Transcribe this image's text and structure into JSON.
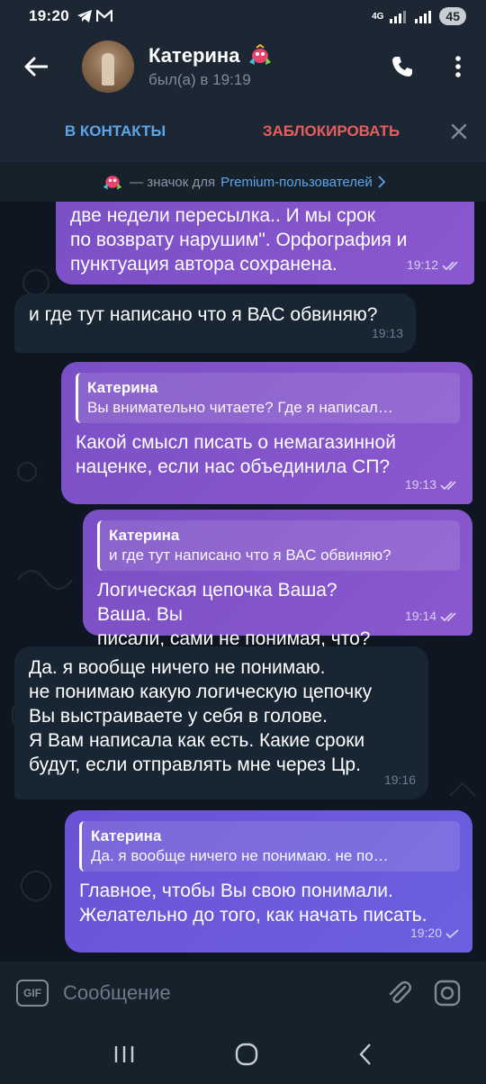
{
  "status_bar": {
    "time": "19:20",
    "network": "4G",
    "battery": "45"
  },
  "header": {
    "contact_name": "Катерина",
    "last_seen": "был(а) в 19:19"
  },
  "action_bar": {
    "add_contact": "В КОНТАКТЫ",
    "block": "ЗАБЛОКИРОВАТЬ"
  },
  "premium_banner": {
    "text": "— значок для",
    "link": "Premium-пользователей"
  },
  "messages": [
    {
      "text": "две недели пересылка.. И мы срок\nпо возврату нарушим\". Орфография и\nпунктуация автора сохранена.",
      "time": "19:12"
    },
    {
      "text": "и где тут написано что я ВАС обвиняю?",
      "time": "19:13"
    },
    {
      "reply_name": "Катерина",
      "reply_text": "Вы внимательно читаете?  Где я написал…",
      "text": "Какой смысл писать о немагазинной\nнаценке, если нас объединила СП?",
      "time": "19:13"
    },
    {
      "reply_name": "Катерина",
      "reply_text": "и где тут написано что я ВАС обвиняю?",
      "text": "Логическая цепочка Ваша? Ваша. Вы\nписали, сами не понимая, что?",
      "time": "19:14"
    },
    {
      "text": "Да. я вообще ничего не понимаю.\nне понимаю какую логическую цепочку\nВы выстраиваете у себя в голове.\nЯ Вам написала как есть.  Какие сроки\nбудут, если отправлять мне через Цр.",
      "time": "19:16"
    },
    {
      "reply_name": "Катерина",
      "reply_text": "Да. я вообще ничего не понимаю. не по…",
      "text": "Главное, чтобы Вы свою понимали.\nЖелательно до того, как начать писать.",
      "time": "19:20"
    }
  ],
  "input": {
    "gif_label": "GIF",
    "placeholder": "Сообщение"
  },
  "colors": {
    "accent": "#5ca5e9",
    "danger": "#e55f5f",
    "incoming_bubble": "#182533",
    "outgoing_bubble": "#8b58cf"
  }
}
